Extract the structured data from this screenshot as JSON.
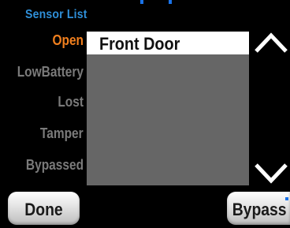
{
  "screen": {
    "title": "Sensor List"
  },
  "filters": [
    {
      "label": "Open",
      "active": true
    },
    {
      "label": "LowBattery",
      "active": false
    },
    {
      "label": "Lost",
      "active": false
    },
    {
      "label": "Tamper",
      "active": false
    },
    {
      "label": "Bypassed",
      "active": false
    }
  ],
  "sensor_list": {
    "items": [
      {
        "label": "Front Door",
        "selected": true
      }
    ]
  },
  "scroll": {
    "up_icon": "chevron-up-icon",
    "down_icon": "chevron-down-icon"
  },
  "buttons": {
    "done_label": "Done",
    "bypass_label": "Bypass"
  },
  "colors": {
    "background": "#000000",
    "title": "#2f8fd8",
    "active_filter": "#f07f1e",
    "inactive_filter": "#7a7a7a",
    "list_panel": "#666666",
    "selected_row": "#ffffff"
  }
}
